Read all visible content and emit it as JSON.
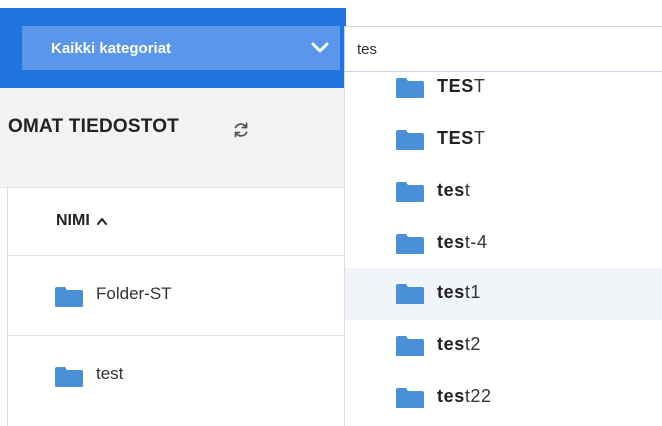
{
  "header": {
    "category_select": {
      "label": "Kaikki kategoriat",
      "icon": "chevron-down-icon"
    },
    "search": {
      "value": "tes"
    }
  },
  "left_panel": {
    "title": "OMAT TIEDOSTOT",
    "refresh_icon": "refresh-icon",
    "column_header": {
      "label": "NIMI",
      "sort_icon": "sort-ascending-icon"
    },
    "rows": [
      {
        "name": "Folder-ST",
        "icon": "folder-icon"
      },
      {
        "name": "test",
        "icon": "folder-icon"
      }
    ]
  },
  "search_results": {
    "match": "tes",
    "items": [
      {
        "match": "TES",
        "rest": "T",
        "icon": "folder-icon"
      },
      {
        "match": "TES",
        "rest": "T",
        "icon": "folder-icon"
      },
      {
        "match": "tes",
        "rest": "t",
        "icon": "folder-icon"
      },
      {
        "match": "tes",
        "rest": "t-4",
        "icon": "folder-icon"
      },
      {
        "match": "tes",
        "rest": "t1",
        "icon": "folder-icon",
        "highlighted": true
      },
      {
        "match": "tes",
        "rest": "t2",
        "icon": "folder-icon"
      },
      {
        "match": "tes",
        "rest": "t22",
        "icon": "folder-icon"
      }
    ]
  },
  "colors": {
    "brand_blue": "#1e73e0",
    "select_blue": "#5a96ea",
    "folder_blue": "#4a90d9",
    "highlight": "#f1f4f8"
  }
}
